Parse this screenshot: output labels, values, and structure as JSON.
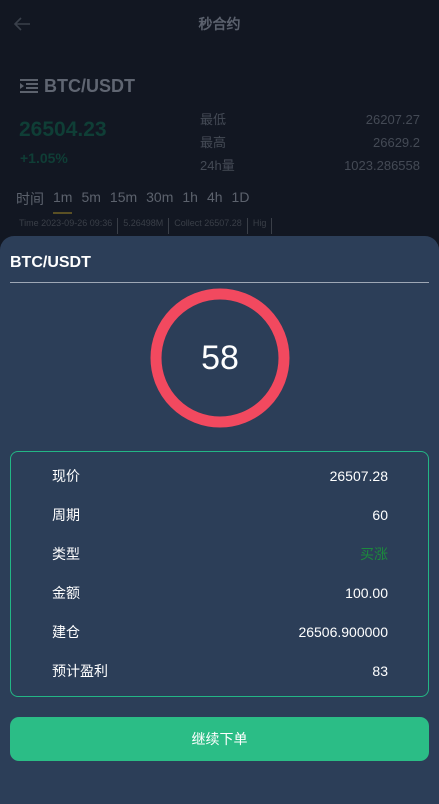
{
  "header": {
    "title": "秒合约",
    "back_icon": "arrow-left-icon"
  },
  "market": {
    "pair": "BTC/USDT",
    "price": "26504.23",
    "change": "+1.05%",
    "stats": [
      {
        "label": "最低",
        "value": "26207.27"
      },
      {
        "label": "最高",
        "value": "26629.2"
      },
      {
        "label": "24h量",
        "value": "1023.286558"
      }
    ]
  },
  "timeframes": {
    "label": "时间",
    "items": [
      "1m",
      "5m",
      "15m",
      "30m",
      "1h",
      "4h",
      "1D"
    ],
    "active": "1m"
  },
  "ticker": [
    "Time 2023-09-26 09:36",
    "5.26498M",
    "Collect 26507.28",
    "Hig"
  ],
  "order_modal": {
    "title": "BTC/USDT",
    "countdown": "58",
    "rows": [
      {
        "label": "现价",
        "value": "26507.28"
      },
      {
        "label": "周期",
        "value": "60"
      },
      {
        "label": "类型",
        "value": "买涨"
      },
      {
        "label": "金额",
        "value": "100.00"
      },
      {
        "label": "建仓",
        "value": "26506.900000"
      },
      {
        "label": "预计盈利",
        "value": "83"
      }
    ],
    "continue_label": "继续下单"
  },
  "colors": {
    "accent_green": "#2bbd86",
    "ring_red": "#f2495f",
    "buy_up_green": "#1c8a3d",
    "modal_bg": "#2c3e58"
  }
}
